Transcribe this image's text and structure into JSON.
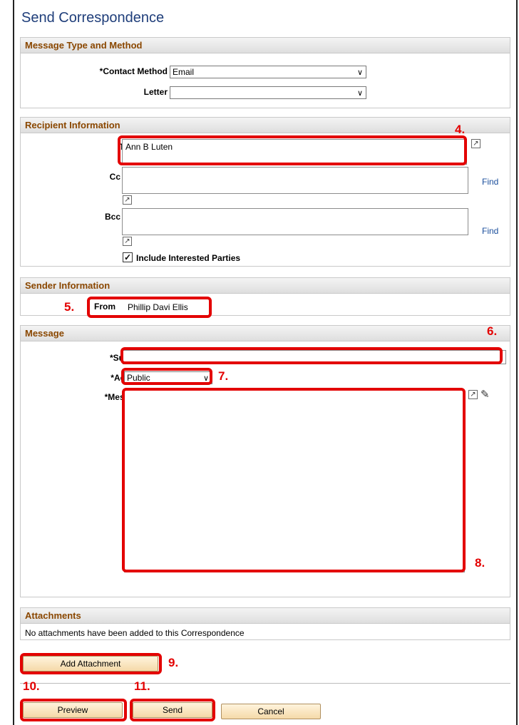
{
  "page": {
    "title": "Send Correspondence"
  },
  "message_type": {
    "header": "Message Type and Method",
    "contact_method_label": "*Contact Method",
    "contact_method_value": "Email",
    "letter_label": "Letter",
    "letter_value": ""
  },
  "recipient": {
    "header": "Recipient Information",
    "to_label": "To",
    "to_value": "Ann B Luten",
    "cc_label": "Cc",
    "cc_value": "",
    "bcc_label": "Bcc",
    "bcc_value": "",
    "find_label": "Find",
    "interested_parties_label": "Include Interested Parties",
    "interested_parties_checked": true
  },
  "sender": {
    "header": "Sender Information",
    "from_label": "From",
    "from_value": "Phillip Davi Ellis"
  },
  "message": {
    "header": "Message",
    "subject_label": "*Subject",
    "subject_value": "",
    "access_label": "*Access",
    "access_value": "Public",
    "message_label": "*Message",
    "message_value": ""
  },
  "attachments": {
    "header": "Attachments",
    "empty_text": "No attachments have been added to this Correspondence",
    "add_button": "Add Attachment"
  },
  "buttons": {
    "preview": "Preview",
    "send": "Send",
    "cancel": "Cancel"
  },
  "steps": {
    "s4": "4.",
    "s5": "5.",
    "s6": "6.",
    "s7": "7.",
    "s8": "8.",
    "s9": "9.",
    "s10": "10.",
    "s11": "11."
  },
  "icons": {
    "expand": "expand-icon",
    "spell_check": "spell-check-icon",
    "checkbox": "checkbox-checked-icon",
    "chevron": "chevron-down-icon"
  },
  "colors": {
    "annotation_red": "#e30000",
    "header_text": "#8a4700",
    "title_blue": "#1f3e7a",
    "link_blue": "#1b4f9c"
  }
}
